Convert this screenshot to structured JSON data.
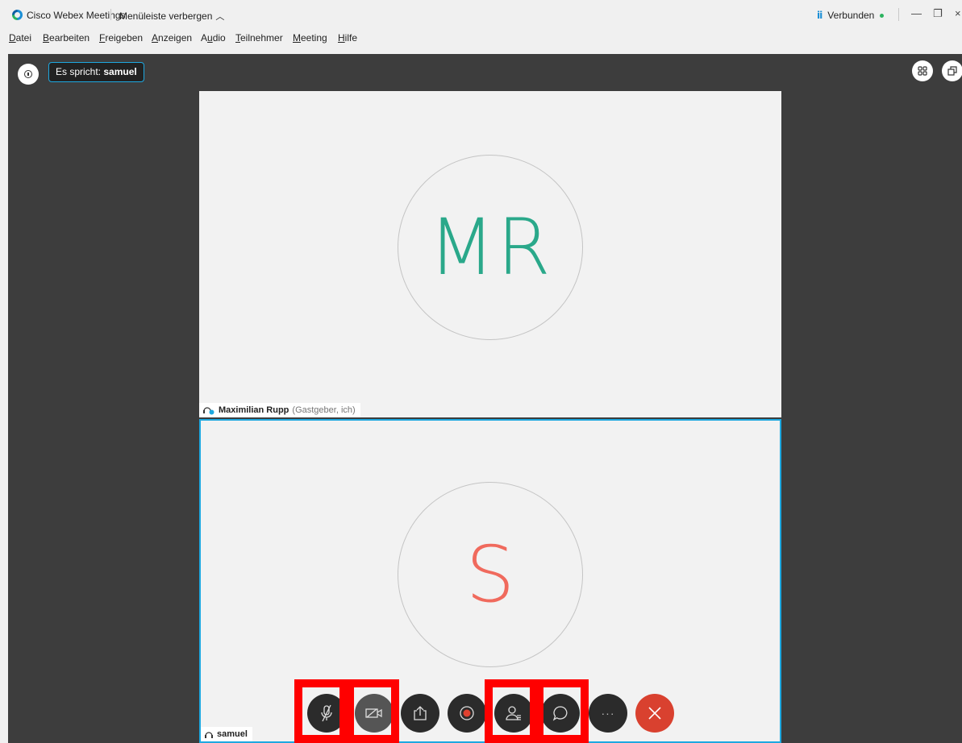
{
  "titlebar": {
    "app_title": "Cisco Webex Meetings",
    "hide_menu_label": "Menüleiste verbergen",
    "connection_status": "Verbunden",
    "accent_color": "#1b8fd6",
    "status_color": "#2cb35f"
  },
  "menu": {
    "items": [
      {
        "first": "D",
        "rest": "atei"
      },
      {
        "first": "B",
        "rest": "earbeiten"
      },
      {
        "first": "F",
        "rest": "reigeben"
      },
      {
        "first": "A",
        "rest": "nzeigen"
      },
      {
        "first": "Au",
        "rest": "dio",
        "underline_index": 1
      },
      {
        "first": "T",
        "rest": "eilnehmer"
      },
      {
        "first": "M",
        "rest": "eeting"
      },
      {
        "first": "H",
        "rest": "ilfe"
      }
    ]
  },
  "stage": {
    "speaker_prefix": "Es spricht:",
    "speaker_name": "samuel"
  },
  "participants": [
    {
      "initials": "MR",
      "name": "Maximilian Rupp",
      "role": "(Gastgeber, ich)",
      "initials_color": "#2aa88a"
    },
    {
      "initials": "S",
      "name": "samuel",
      "role": "",
      "initials_color": "#f06a5d"
    }
  ],
  "controls": {
    "buttons": [
      "mute",
      "video",
      "share",
      "record",
      "participants",
      "chat",
      "more",
      "leave"
    ],
    "more_label": "···",
    "highlight_color": "#ff0000"
  }
}
